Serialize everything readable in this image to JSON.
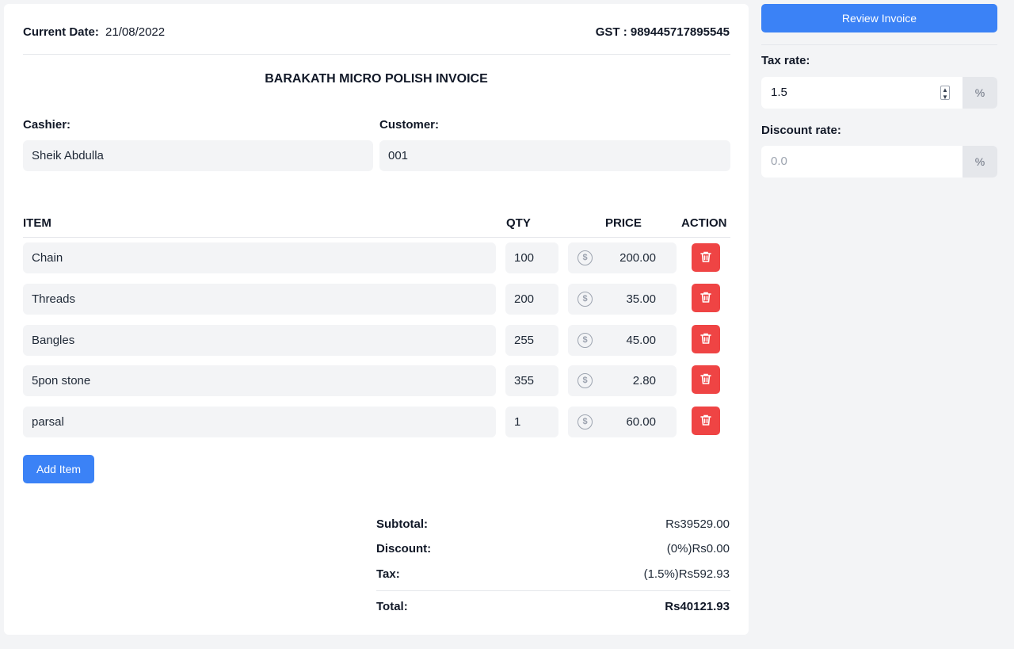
{
  "invoice": {
    "current_date_label": "Current Date:",
    "current_date": "21/08/2022",
    "gst": "GST : 989445717895545",
    "title": "BARAKATH MICRO POLISH INVOICE",
    "cashier_label": "Cashier:",
    "cashier_value": "Sheik Abdulla",
    "customer_label": "Customer:",
    "customer_value": "001",
    "columns": {
      "item": "ITEM",
      "qty": "QTY",
      "price": "PRICE",
      "action": "ACTION"
    },
    "currency_icon": "$",
    "items": [
      {
        "name": "Chain",
        "qty": "100",
        "price": "200.00"
      },
      {
        "name": "Threads",
        "qty": "200",
        "price": "35.00"
      },
      {
        "name": "Bangles",
        "qty": "255",
        "price": "45.00"
      },
      {
        "name": "5pon stone",
        "qty": "355",
        "price": "2.80"
      },
      {
        "name": "parsal",
        "qty": "1",
        "price": "60.00"
      }
    ],
    "add_item_label": "Add Item",
    "subtotal_label": "Subtotal:",
    "subtotal_value": "Rs39529.00",
    "discount_label": "Discount:",
    "discount_value": "(0%)Rs0.00",
    "tax_label": "Tax:",
    "tax_value": "(1.5%)Rs592.93",
    "total_label": "Total:",
    "total_value": "Rs40121.93"
  },
  "sidebar": {
    "review_label": "Review Invoice",
    "tax_rate_label": "Tax rate:",
    "tax_rate_value": "1.5",
    "tax_unit": "%",
    "discount_rate_label": "Discount rate:",
    "discount_rate_placeholder": "0.0",
    "discount_unit": "%"
  },
  "colors": {
    "primary": "#3b82f6",
    "danger": "#ef4444",
    "field_bg": "#f3f4f6"
  }
}
